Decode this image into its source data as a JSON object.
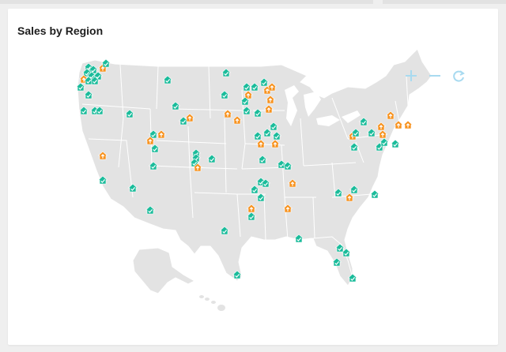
{
  "widget": {
    "title": "Sales by Region"
  },
  "controls": {
    "zoom_in_icon": "plus-icon",
    "zoom_out_icon": "minus-icon",
    "reset_icon": "refresh-icon"
  },
  "colors": {
    "map_fill": "#e3e3e3",
    "map_border": "#ffffff",
    "marker_check": "#1bbc9b",
    "marker_up": "#f7921e",
    "control": "#a8daf0"
  },
  "legend_meaning": {
    "check": "house-check-marker",
    "up": "house-up-arrow-marker"
  }
}
